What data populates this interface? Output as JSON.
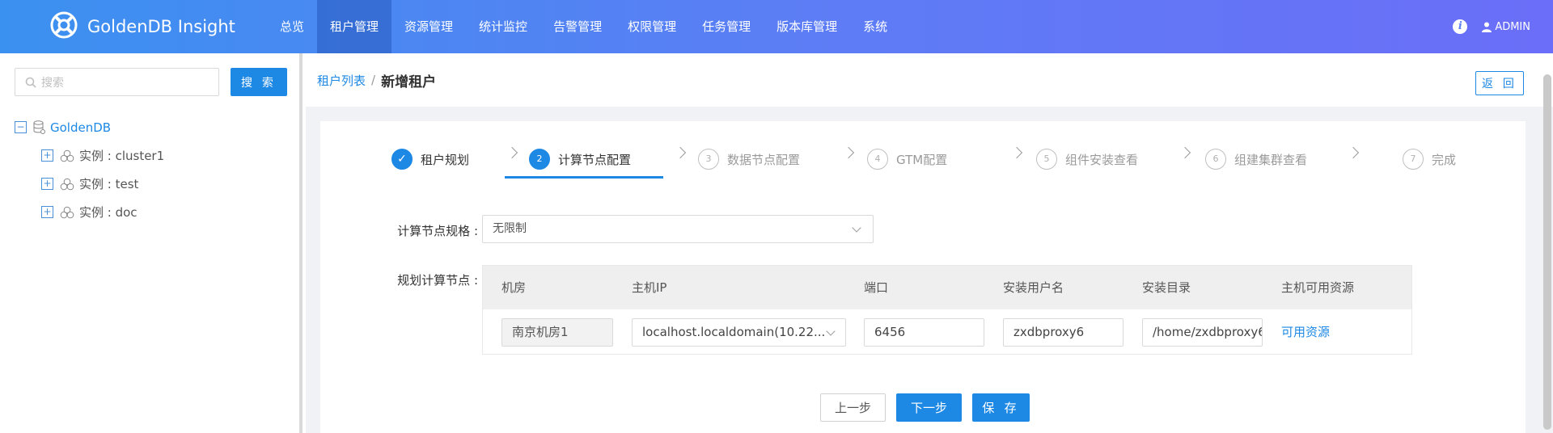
{
  "header": {
    "brand": "GoldenDB Insight",
    "nav": [
      "总览",
      "租户管理",
      "资源管理",
      "统计监控",
      "告警管理",
      "权限管理",
      "任务管理",
      "版本库管理",
      "系统"
    ],
    "active_nav_index": 1,
    "user": "ADMIN"
  },
  "sidebar": {
    "search_placeholder": "搜索",
    "search_button": "搜 索",
    "tree": {
      "root": "GoldenDB",
      "children": [
        "实例 : cluster1",
        "实例 : test",
        "实例 : doc"
      ]
    }
  },
  "breadcrumb": {
    "parent": "租户列表",
    "separator": "/",
    "current": "新增租户"
  },
  "back_button": "返 回",
  "steps": [
    {
      "num": "✓",
      "label": "租户规划",
      "state": "done"
    },
    {
      "num": "2",
      "label": "计算节点配置",
      "state": "active"
    },
    {
      "num": "3",
      "label": "数据节点配置",
      "state": "pending"
    },
    {
      "num": "4",
      "label": "GTM配置",
      "state": "pending"
    },
    {
      "num": "5",
      "label": "组件安装查看",
      "state": "pending"
    },
    {
      "num": "6",
      "label": "组建集群查看",
      "state": "pending"
    },
    {
      "num": "7",
      "label": "完成",
      "state": "pending"
    }
  ],
  "form": {
    "spec_label": "计算节点规格 :",
    "spec_value": "无限制",
    "plan_label": "规划计算节点 :",
    "columns": [
      "机房",
      "主机IP",
      "端口",
      "安装用户名",
      "安装目录",
      "主机可用资源"
    ],
    "row": {
      "room": "南京机房1",
      "host_ip": "localhost.localdomain(10.22...",
      "port": "6456",
      "user": "zxdbproxy6",
      "dir": "/home/zxdbproxy6",
      "resource_link": "可用资源"
    }
  },
  "buttons": {
    "prev": "上一步",
    "next": "下一步",
    "save": "保 存"
  },
  "colors": {
    "primary": "#1e88e5",
    "header_gradient_start": "#3b91f0",
    "header_gradient_end": "#6a6ef8"
  }
}
